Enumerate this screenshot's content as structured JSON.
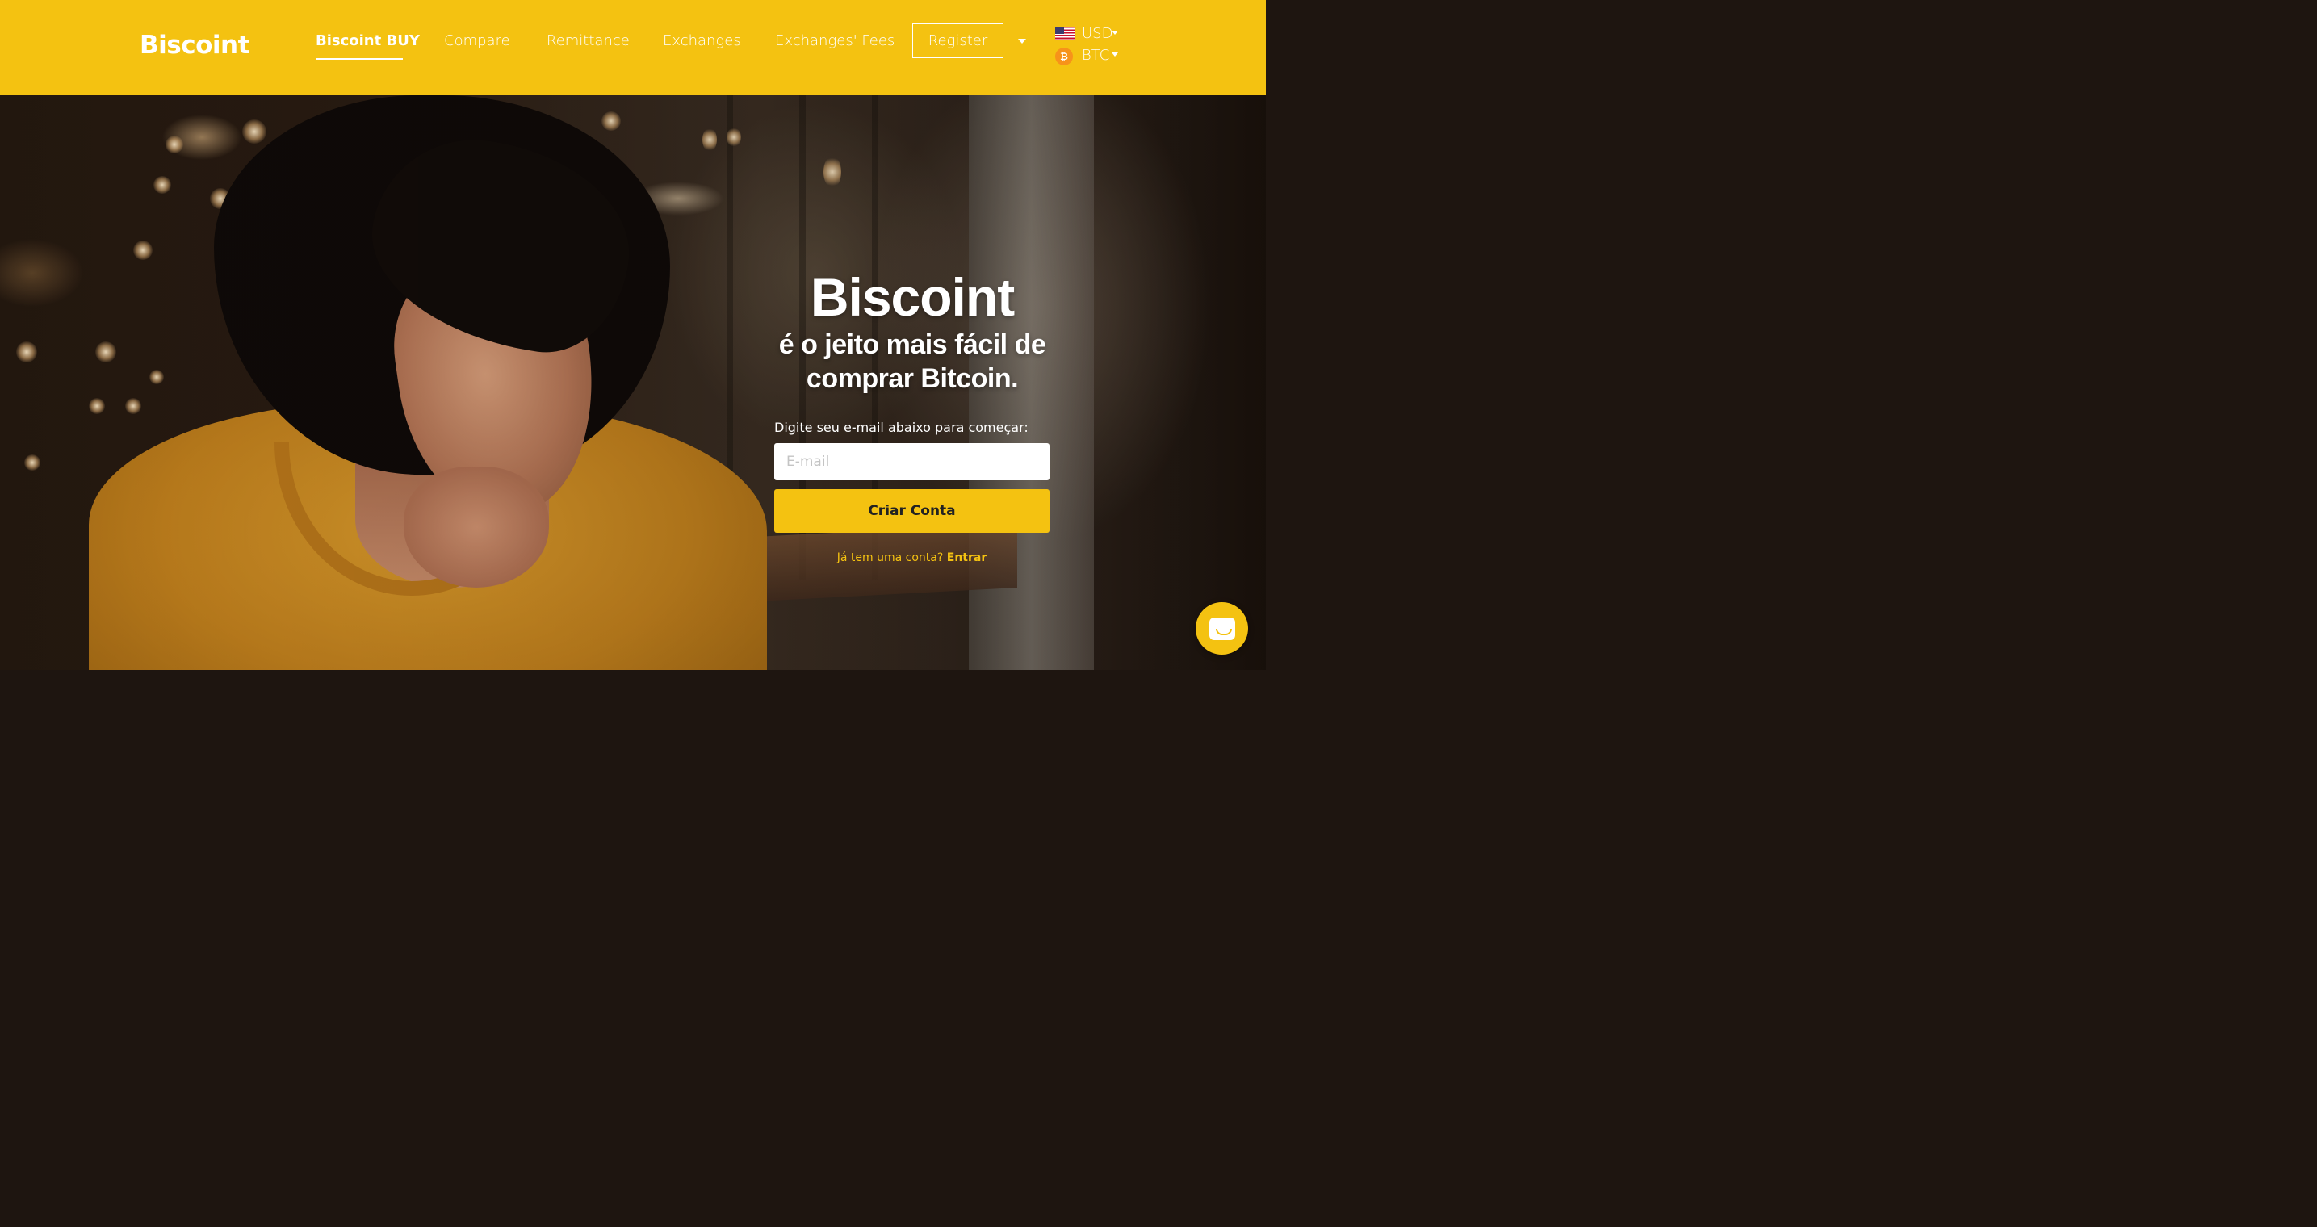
{
  "header": {
    "logo": "Biscoint",
    "nav": [
      {
        "label": "Biscoint BUY",
        "active": true
      },
      {
        "label": "Compare"
      },
      {
        "label": "Remittance"
      },
      {
        "label": "Exchanges"
      },
      {
        "label": "Exchanges' Fees"
      }
    ],
    "register_label": "Register",
    "currency": {
      "label": "USD",
      "icon": "us-flag-icon"
    },
    "crypto": {
      "label": "BTC",
      "icon": "bitcoin-icon",
      "symbol": "₿"
    }
  },
  "hero": {
    "title": "Biscoint",
    "subtitle": "é o jeito mais fácil de comprar Bitcoin.",
    "email_label": "Digite seu e-mail abaixo para começar:",
    "email_placeholder": "E-mail",
    "email_value": "",
    "cta_label": "Criar Conta",
    "login_prompt": "Já tem uma conta?",
    "login_link": "Entrar"
  },
  "chat": {
    "icon": "chat-icon"
  },
  "colors": {
    "brand": "#f4c211",
    "text_on_brand": "#ffffff",
    "cta_text": "#222222"
  }
}
